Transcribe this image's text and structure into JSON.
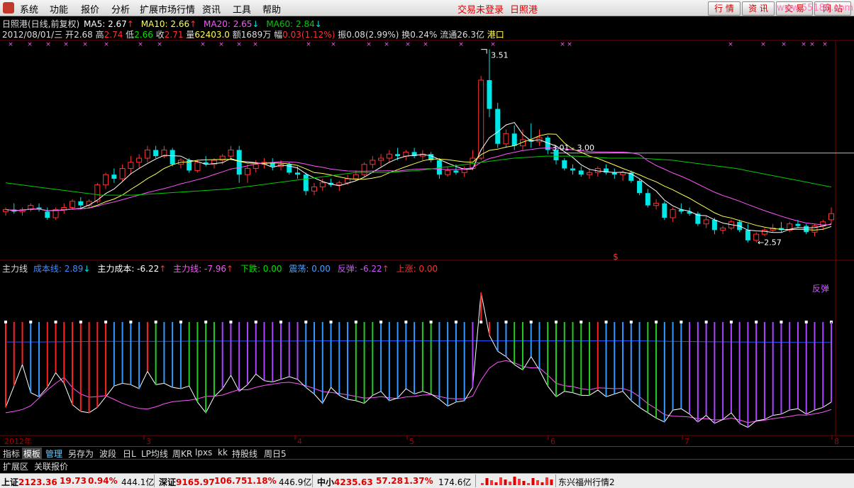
{
  "menu": {
    "items": [
      "系统",
      "功能",
      "报价",
      "分析",
      "扩展市场行情",
      "资讯",
      "工具",
      "帮助"
    ],
    "login_status": "交易未登录",
    "stock_name": "日照港",
    "right_buttons": [
      "行 情",
      "资 讯",
      "交 易",
      "网 站"
    ],
    "watermark": "www.55188.com"
  },
  "header": {
    "title": "日照港(日线,前复权)",
    "ma5": "MA5: 2.67",
    "ma10": "MA10: 2.66",
    "ma20": "MA20: 2.65",
    "ma60": "MA60: 2.84",
    "date": "2012/08/01/三",
    "open_label": "开",
    "open": "2.68",
    "high_label": "高",
    "high": "2.74",
    "low_label": "低",
    "low": "2.66",
    "close_label": "收",
    "close": "2.71",
    "vol_label": "量",
    "vol": "62403.0",
    "amount_label": "额",
    "amount": "1689万",
    "range_label": "幅",
    "range": "0.03(1.12%)",
    "amp_label": "振",
    "amp": "0.08(2.99%)",
    "turn_label": "换",
    "turn": "0.24%",
    "float_label": "流通",
    "float": "26.3亿",
    "sector": "港口"
  },
  "indicator": {
    "name": "主力线",
    "cost_line": "成本线: 2.89",
    "main_cost": "主力成本: -6.22",
    "main_line": "主力线: -7.96",
    "fall": "下跌: 0.00",
    "shock": "震荡: 0.00",
    "rebound": "反弹: -6.22",
    "rise": "上涨: 0.00",
    "rebound_tag": "反弹"
  },
  "annotations": {
    "high": "3.51",
    "range": "3.01 - 3.00",
    "low": "2.57",
    "dollar": "$"
  },
  "x_axis": {
    "year_label": "2012年",
    "months": [
      "3",
      "4",
      "5",
      "6",
      "7",
      "8"
    ]
  },
  "tabs": [
    "指标",
    "模板",
    "管理",
    "另存为",
    "波段",
    "日L",
    "LP均线",
    "周KR",
    "lpxs",
    "kk",
    "持股线",
    "周日5"
  ],
  "tabs2": [
    "扩展区",
    "关联报价"
  ],
  "bottom": {
    "sh_label": "上证",
    "sh_value": "2123.36",
    "sh_chg": "19.73",
    "sh_pct": "0.94%",
    "sh_amt": "444.1亿",
    "sz_label": "深证",
    "sz_value": "9165.97",
    "sz_chg": "106.75",
    "sz_pct": "1.18%",
    "sz_amt": "446.9亿",
    "zx_label": "中小",
    "zx_value": "4235.63",
    "zx_chg": "57.28",
    "zx_pct": "1.37%",
    "zx_amt": "174.6亿",
    "feed": "东兴福州行情2"
  },
  "colors": {
    "up": "#ff3232",
    "down": "#00e6e6",
    "ma5": "#ffffff",
    "ma10": "#ffff55",
    "ma20": "#ff55ff",
    "ma60": "#00cc00",
    "cost": "#2255ff"
  },
  "chart_data": {
    "type": "candlestick",
    "price_range": [
      2.5,
      3.55
    ],
    "candles": [
      [
        2.72,
        2.74,
        2.7,
        2.73
      ],
      [
        2.73,
        2.76,
        2.71,
        2.72
      ],
      [
        2.72,
        2.74,
        2.7,
        2.73
      ],
      [
        2.73,
        2.76,
        2.72,
        2.75
      ],
      [
        2.74,
        2.76,
        2.72,
        2.73
      ],
      [
        2.72,
        2.74,
        2.68,
        2.69
      ],
      [
        2.69,
        2.74,
        2.68,
        2.73
      ],
      [
        2.73,
        2.76,
        2.71,
        2.74
      ],
      [
        2.74,
        2.78,
        2.73,
        2.77
      ],
      [
        2.77,
        2.79,
        2.73,
        2.75
      ],
      [
        2.75,
        2.78,
        2.74,
        2.77
      ],
      [
        2.77,
        2.86,
        2.76,
        2.85
      ],
      [
        2.85,
        2.91,
        2.83,
        2.9
      ],
      [
        2.9,
        2.93,
        2.86,
        2.88
      ],
      [
        2.88,
        2.95,
        2.87,
        2.93
      ],
      [
        2.93,
        2.99,
        2.9,
        2.96
      ],
      [
        2.96,
        3.0,
        2.93,
        2.98
      ],
      [
        2.98,
        3.04,
        2.96,
        3.02
      ],
      [
        3.02,
        3.04,
        2.98,
        2.99
      ],
      [
        2.99,
        3.04,
        2.98,
        3.02
      ],
      [
        3.02,
        3.03,
        2.94,
        2.95
      ],
      [
        2.95,
        2.98,
        2.93,
        2.97
      ],
      [
        2.97,
        2.98,
        2.91,
        2.92
      ],
      [
        2.92,
        2.97,
        2.91,
        2.96
      ],
      [
        2.96,
        2.99,
        2.94,
        2.95
      ],
      [
        2.95,
        2.98,
        2.93,
        2.97
      ],
      [
        2.97,
        3.0,
        2.95,
        2.99
      ],
      [
        2.99,
        3.04,
        2.97,
        3.02
      ],
      [
        3.02,
        3.04,
        2.86,
        2.9
      ],
      [
        2.9,
        2.95,
        2.86,
        2.93
      ],
      [
        2.93,
        2.97,
        2.91,
        2.95
      ],
      [
        2.95,
        2.98,
        2.93,
        2.96
      ],
      [
        2.96,
        2.98,
        2.92,
        2.94
      ],
      [
        2.94,
        2.97,
        2.92,
        2.95
      ],
      [
        2.95,
        2.96,
        2.9,
        2.91
      ],
      [
        2.91,
        2.94,
        2.88,
        2.9
      ],
      [
        2.9,
        2.91,
        2.8,
        2.82
      ],
      [
        2.82,
        2.86,
        2.8,
        2.84
      ],
      [
        2.84,
        2.88,
        2.82,
        2.86
      ],
      [
        2.86,
        2.88,
        2.84,
        2.85
      ],
      [
        2.85,
        2.87,
        2.82,
        2.86
      ],
      [
        2.86,
        2.9,
        2.85,
        2.88
      ],
      [
        2.88,
        2.92,
        2.87,
        2.9
      ],
      [
        2.9,
        2.96,
        2.89,
        2.95
      ],
      [
        2.95,
        2.99,
        2.93,
        2.97
      ],
      [
        2.97,
        3.0,
        2.94,
        2.98
      ],
      [
        2.98,
        3.02,
        2.96,
        3.0
      ],
      [
        3.0,
        3.03,
        2.97,
        2.99
      ],
      [
        2.99,
        3.02,
        2.97,
        3.01
      ],
      [
        3.01,
        3.03,
        2.98,
        2.99
      ],
      [
        2.99,
        3.02,
        2.97,
        3.0
      ],
      [
        3.0,
        3.01,
        2.96,
        2.97
      ],
      [
        2.97,
        2.98,
        2.88,
        2.9
      ],
      [
        2.9,
        2.94,
        2.89,
        2.92
      ],
      [
        2.92,
        2.95,
        2.9,
        2.91
      ],
      [
        2.91,
        2.94,
        2.89,
        2.93
      ],
      [
        2.93,
        3.02,
        2.92,
        2.98
      ],
      [
        2.98,
        3.38,
        2.97,
        3.36
      ],
      [
        3.36,
        3.51,
        3.18,
        3.22
      ],
      [
        3.22,
        3.25,
        3.03,
        3.05
      ],
      [
        3.05,
        3.12,
        3.03,
        3.1
      ],
      [
        3.1,
        3.14,
        3.02,
        3.04
      ],
      [
        3.04,
        3.12,
        3.02,
        3.07
      ],
      [
        3.07,
        3.15,
        3.03,
        3.06
      ],
      [
        3.06,
        3.12,
        3.04,
        3.08
      ],
      [
        3.08,
        3.09,
        3.0,
        3.02
      ],
      [
        3.02,
        3.04,
        2.95,
        2.97
      ],
      [
        2.97,
        2.98,
        2.92,
        2.93
      ],
      [
        2.93,
        2.95,
        2.9,
        2.92
      ],
      [
        2.92,
        2.94,
        2.89,
        2.9
      ],
      [
        2.9,
        2.93,
        2.88,
        2.91
      ],
      [
        2.91,
        2.94,
        2.89,
        2.93
      ],
      [
        2.93,
        2.95,
        2.9,
        2.91
      ],
      [
        2.91,
        2.93,
        2.88,
        2.9
      ],
      [
        2.9,
        2.92,
        2.87,
        2.91
      ],
      [
        2.91,
        2.92,
        2.86,
        2.87
      ],
      [
        2.87,
        2.88,
        2.8,
        2.81
      ],
      [
        2.81,
        2.83,
        2.74,
        2.75
      ],
      [
        2.75,
        2.78,
        2.73,
        2.76
      ],
      [
        2.76,
        2.77,
        2.68,
        2.69
      ],
      [
        2.69,
        2.74,
        2.67,
        2.73
      ],
      [
        2.73,
        2.76,
        2.71,
        2.72
      ],
      [
        2.72,
        2.74,
        2.7,
        2.71
      ],
      [
        2.71,
        2.72,
        2.65,
        2.66
      ],
      [
        2.66,
        2.7,
        2.64,
        2.68
      ],
      [
        2.68,
        2.69,
        2.61,
        2.63
      ],
      [
        2.63,
        2.65,
        2.61,
        2.64
      ],
      [
        2.64,
        2.68,
        2.63,
        2.67
      ],
      [
        2.67,
        2.68,
        2.62,
        2.63
      ],
      [
        2.63,
        2.66,
        2.57,
        2.58
      ],
      [
        2.58,
        2.62,
        2.57,
        2.61
      ],
      [
        2.61,
        2.64,
        2.6,
        2.63
      ],
      [
        2.63,
        2.66,
        2.62,
        2.64
      ],
      [
        2.64,
        2.67,
        2.62,
        2.63
      ],
      [
        2.63,
        2.67,
        2.62,
        2.66
      ],
      [
        2.66,
        2.68,
        2.64,
        2.65
      ],
      [
        2.65,
        2.66,
        2.61,
        2.62
      ],
      [
        2.62,
        2.66,
        2.6,
        2.65
      ],
      [
        2.65,
        2.68,
        2.63,
        2.67
      ],
      [
        2.68,
        2.74,
        2.66,
        2.71
      ]
    ],
    "ma60": [
      2.86,
      2.84,
      2.82,
      2.8,
      2.8,
      2.81,
      2.82,
      2.83,
      2.85,
      2.87,
      2.89,
      2.91,
      2.91,
      2.92,
      2.94,
      2.96,
      2.98,
      2.99,
      2.99,
      2.98,
      2.98,
      2.97,
      2.95,
      2.93,
      2.9,
      2.87,
      2.84
    ],
    "indicator_range": [
      -20,
      40
    ],
    "cost_line": [
      14.5,
      14.5,
      14.6,
      14.7,
      14.7,
      14.7,
      14.8,
      14.8,
      14.8,
      14.8,
      14.9,
      14.9,
      14.9,
      14.9,
      14.9,
      14.9,
      14.9,
      14.9,
      14.9,
      14.9,
      14.9,
      14.7,
      14.6,
      14.5,
      14.4,
      14.3,
      14.3
    ],
    "main_line": [
      -12.0,
      -11.5,
      -10.8,
      -9.4,
      -6.5,
      -3.5,
      -1.0,
      1.2,
      -2.6,
      -5.0,
      -6.2,
      -6.0,
      -5.6,
      -7.0,
      -8.5,
      -9.6,
      -10.4,
      -10.6,
      -9.8,
      -8.7,
      -7.9,
      -7.6,
      -7.3,
      -6.8,
      -5.9,
      -5.8,
      -5.4,
      -4.3,
      -3.3,
      -3.4,
      -2.5,
      -1.8,
      -1.3,
      -0.8,
      -0.6,
      -1.1,
      -1.9,
      -2.9,
      -4.1,
      -4.4,
      -4.8,
      -5.3,
      -5.9,
      -6.5,
      -6.4,
      -6.0,
      -6.4,
      -6.7,
      -6.1,
      -5.9,
      -5.4,
      -5.2,
      -5.9,
      -6.6,
      -6.8,
      -6.8,
      -5.8,
      0.2,
      4.7,
      6.9,
      7.5,
      6.7,
      5.3,
      4.8,
      4.8,
      2.1,
      -1.0,
      -1.9,
      -2.2,
      -3.0,
      -3.4,
      -2.7,
      -2.8,
      -3.0,
      -2.9,
      -3.9,
      -6.0,
      -8.6,
      -10.5,
      -12.7,
      -13.3,
      -13.4,
      -13.6,
      -14.2,
      -14.2,
      -14.7,
      -14.6,
      -14.0,
      -14.7,
      -15.7,
      -15.2,
      -14.8,
      -14.2,
      -13.8,
      -13.4,
      -12.8,
      -12.9,
      -12.4,
      -11.8,
      -10.8
    ],
    "main_cost": [
      -10.0,
      -2.0,
      6.0,
      -4.5,
      -6.0,
      -2.5,
      3.0,
      -1.0,
      -9.0,
      -11.5,
      -12.0,
      -10.0,
      -6.0,
      -2.0,
      -1.0,
      -1.5,
      -3.0,
      3.5,
      -1.5,
      -1.0,
      -2.5,
      -3.0,
      -2.0,
      -8.0,
      -12.0,
      -6.0,
      -3.0,
      2.0,
      -4.0,
      -1.5,
      2.5,
      0.0,
      -0.5,
      0.5,
      1.5,
      0.5,
      -2.5,
      -5.0,
      -8.5,
      -2.5,
      -5.5,
      -7.0,
      -7.5,
      -8.5,
      -5.5,
      -4.0,
      -7.5,
      -6.5,
      -3.0,
      -5.0,
      -4.0,
      -5.0,
      -7.0,
      -9.5,
      -8.0,
      -7.5,
      -2.5,
      33.0,
      17.0,
      11.0,
      9.0,
      6.0,
      4.0,
      9.0,
      4.0,
      -2.0,
      -6.0,
      -4.0,
      -4.5,
      -5.5,
      -5.5,
      -3.5,
      -6.0,
      -5.0,
      -4.0,
      -7.5,
      -10.0,
      -12.0,
      -14.0,
      -15.5,
      -11.0,
      -10.5,
      -12.5,
      -15.5,
      -13.0,
      -16.0,
      -14.5,
      -12.0,
      -16.0,
      -17.5,
      -15.0,
      -14.5,
      -13.0,
      -12.5,
      -11.0,
      -10.5,
      -12.5,
      -11.0,
      -10.0,
      -8.0
    ],
    "hist_colors": [
      "red",
      "red",
      "red",
      "blue",
      "blue",
      "red",
      "red",
      "red",
      "red",
      "red",
      "red",
      "red",
      "red",
      "blue",
      "blue",
      "blue",
      "blue",
      "red",
      "green",
      "blue",
      "blue",
      "blue",
      "green",
      "green",
      "green",
      "green",
      "purple",
      "purple",
      "purple",
      "purple",
      "purple",
      "purple",
      "purple",
      "purple",
      "purple",
      "purple",
      "blue",
      "blue",
      "blue",
      "blue",
      "blue",
      "blue",
      "green",
      "green",
      "green",
      "blue",
      "blue",
      "blue",
      "blue",
      "blue",
      "green",
      "green",
      "blue",
      "blue",
      "blue",
      "blue",
      "purple",
      "red",
      "red",
      "blue",
      "blue",
      "green",
      "green",
      "blue",
      "blue",
      "green",
      "green",
      "green",
      "green",
      "green",
      "green",
      "red",
      "blue",
      "blue",
      "blue",
      "blue",
      "blue",
      "green",
      "green",
      "blue",
      "blue",
      "blue",
      "purple",
      "purple",
      "purple",
      "purple",
      "purple",
      "purple",
      "purple",
      "purple",
      "purple",
      "purple",
      "purple",
      "purple",
      "purple",
      "purple",
      "purple",
      "purple",
      "purple",
      "purple"
    ]
  }
}
